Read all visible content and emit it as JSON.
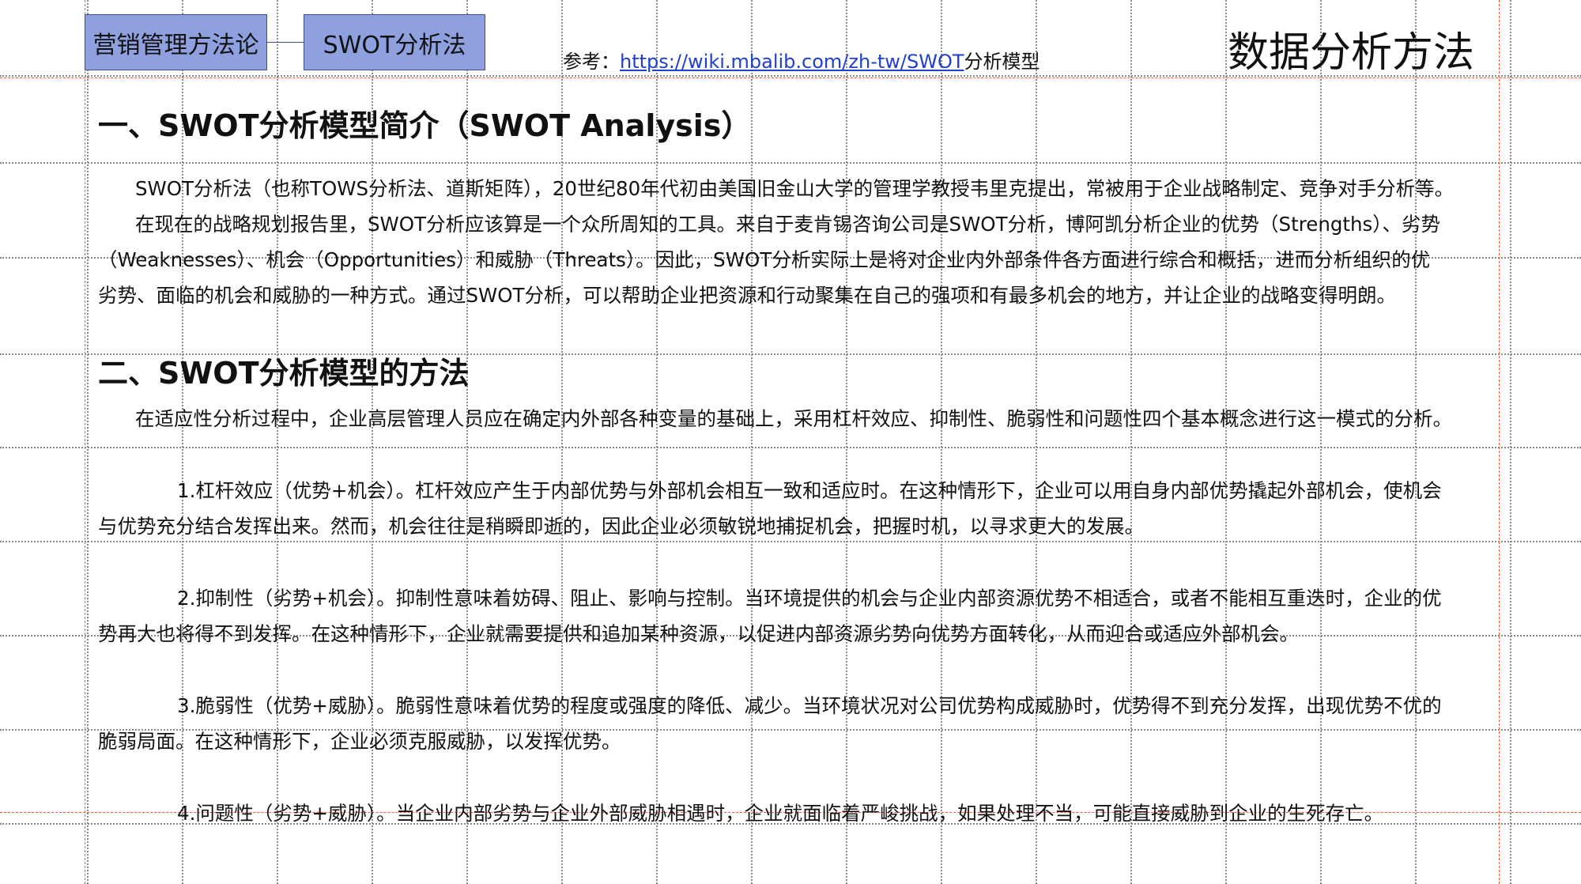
{
  "nav": {
    "box1_label": "营销管理方法论",
    "box2_label": "SWOT分析法"
  },
  "reference": {
    "prefix": "参考：",
    "link_text": "https://wiki.mbalib.com/zh-tw/SWOT",
    "suffix": "分析模型"
  },
  "page_title": "数据分析方法",
  "section1": {
    "heading": "一、SWOT分析模型简介（SWOT Analysis）",
    "lines": [
      "SWOT分析法（也称TOWS分析法、道斯矩阵），20世纪80年代初由美国旧金山大学的管理学教授韦里克提出，常被用于企业战略制定、竞争对手分析等。",
      "在现在的战略规划报告里，SWOT分析应该算是一个众所周知的工具。来自于麦肯锡咨询公司是SWOT分析，博阿凯分析企业的优势（Strengths）、劣势",
      "（Weaknesses）、机会（Opportunities）和威胁（Threats）。因此，SWOT分析实际上是将对企业内外部条件各方面进行综合和概括，进而分析组织的优",
      "劣势、面临的机会和威胁的一种方式。通过SWOT分析，可以帮助企业把资源和行动聚集在自己的强项和有最多机会的地方，并让企业的战略变得明朗。"
    ]
  },
  "section2": {
    "heading": "二、SWOT分析模型的方法",
    "intro": "在适应性分析过程中，企业高层管理人员应在确定内外部各种变量的基础上，采用杠杆效应、抑制性、脆弱性和问题性四个基本概念进行这一模式的分析。",
    "items": [
      {
        "line1": "1.杠杆效应（优势+机会）。杠杆效应产生于内部优势与外部机会相互一致和适应时。在这种情形下，企业可以用自身内部优势撬起外部机会，使机会",
        "line2": "与优势充分结合发挥出来。然而，机会往往是稍瞬即逝的，因此企业必须敏锐地捕捉机会，把握时机，以寻求更大的发展。"
      },
      {
        "line1": "2.抑制性（劣势+机会）。抑制性意味着妨碍、阻止、影响与控制。当环境提供的机会与企业内部资源优势不相适合，或者不能相互重迭时，企业的优",
        "line2": "势再大也将得不到发挥。在这种情形下，企业就需要提供和追加某种资源，以促进内部资源劣势向优势方面转化，从而迎合或适应外部机会。"
      },
      {
        "line1": "3.脆弱性（优势+威胁）。脆弱性意味着优势的程度或强度的降低、减少。当环境状况对公司优势构成威胁时，优势得不到充分发挥，出现优势不优的",
        "line2": "脆弱局面。在这种情形下，企业必须克服威胁，以发挥优势。"
      },
      {
        "line1": "4.问题性（劣势+威胁）。当企业内部劣势与企业外部威胁相遇时，企业就面临着严峻挑战，如果处理不当，可能直接威胁到企业的生死存亡。",
        "line2": ""
      }
    ]
  },
  "colors": {
    "nav_fill": "#8ea0dd",
    "link": "#1f3fcf",
    "guide": "#ff5a2a"
  }
}
